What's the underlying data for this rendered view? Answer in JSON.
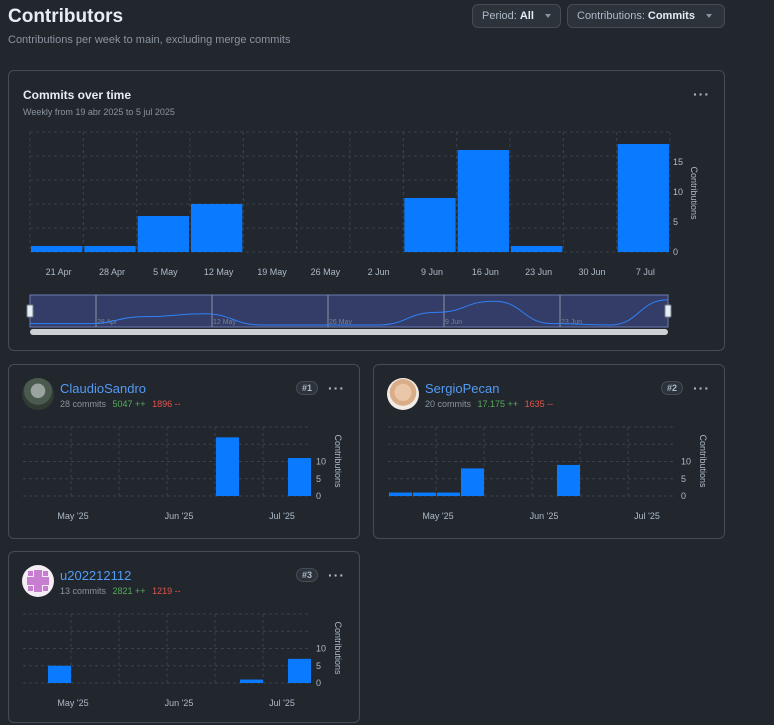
{
  "header": {
    "title": "Contributors",
    "subtitle": "Contributions per week to main, excluding merge commits",
    "period_label": "Period:",
    "period_value": "All",
    "contrib_label": "Contributions:",
    "contrib_value": "Commits"
  },
  "main_chart": {
    "title": "Commits over time",
    "subtitle": "Weekly from 19 abr 2025 to 5 jul 2025",
    "menu_icon": "kebab-horizontal-icon",
    "brush_labels": [
      "28 Apr",
      "12 May",
      "26 May",
      "9 Jun",
      "23 Jun"
    ]
  },
  "contributors": [
    {
      "name": "ClaudioSandro",
      "commits": "28 commits",
      "additions": "5047 ++",
      "deletions": "1896 --",
      "rank": "#1",
      "avatar_icon": "user-photo-avatar"
    },
    {
      "name": "SergioPecan",
      "commits": "20 commits",
      "additions": "17.175 ++",
      "deletions": "1635 --",
      "rank": "#2",
      "avatar_icon": "user-photo-avatar"
    },
    {
      "name": "u202212112",
      "commits": "13 commits",
      "additions": "2821 ++",
      "deletions": "1219 --",
      "rank": "#3",
      "avatar_icon": "identicon-avatar"
    }
  ],
  "colors": {
    "bar": "#0a7bff",
    "accent_link": "#539bf5",
    "additions": "#57ab5a",
    "deletions": "#e5534b"
  },
  "chart_data": [
    {
      "type": "bar",
      "title": "Commits over time",
      "ylabel": "Contributions",
      "categories": [
        "21 Apr",
        "28 Apr",
        "5 May",
        "12 May",
        "19 May",
        "26 May",
        "2 Jun",
        "9 Jun",
        "16 Jun",
        "23 Jun",
        "30 Jun",
        "7 Jul"
      ],
      "values": [
        1,
        1,
        6,
        8,
        0,
        0,
        0,
        9,
        17,
        1,
        0,
        18
      ],
      "yticks": [
        0,
        5,
        10,
        15
      ],
      "ylim": [
        0,
        20
      ]
    },
    {
      "type": "bar",
      "title": "ClaudioSandro",
      "ylabel": "Contributions",
      "xticks": [
        "May '25",
        "Jun '25",
        "Jul '25"
      ],
      "values": [
        0,
        0,
        0,
        0,
        0,
        0,
        0,
        0,
        17,
        0,
        0,
        11
      ],
      "yticks": [
        0,
        5,
        10
      ],
      "ylim": [
        0,
        20
      ]
    },
    {
      "type": "bar",
      "title": "SergioPecan",
      "ylabel": "Contributions",
      "xticks": [
        "May '25",
        "Jun '25",
        "Jul '25"
      ],
      "values": [
        1,
        1,
        1,
        8,
        0,
        0,
        0,
        9,
        0,
        0,
        0,
        0
      ],
      "yticks": [
        0,
        5,
        10
      ],
      "ylim": [
        0,
        20
      ]
    },
    {
      "type": "bar",
      "title": "u202212112",
      "ylabel": "Contributions",
      "xticks": [
        "May '25",
        "Jun '25",
        "Jul '25"
      ],
      "values": [
        0,
        5,
        0,
        0,
        0,
        0,
        0,
        0,
        0,
        1,
        0,
        7
      ],
      "yticks": [
        0,
        5,
        10
      ],
      "ylim": [
        0,
        20
      ]
    }
  ]
}
